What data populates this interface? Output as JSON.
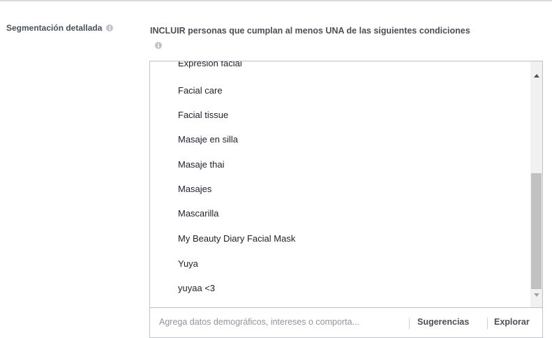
{
  "detailed_targeting": {
    "label": "Segmentación detallada",
    "info_icon": "i",
    "include_heading": "INCLUIR personas que cumplan al menos UNA de las siguientes condiciones",
    "include_info_icon": "i"
  },
  "targeting_list": {
    "partial_item": "Expresión facial",
    "items": [
      "Facial care",
      "Facial tissue",
      "Masaje en silla",
      "Masaje thai",
      "Masajes",
      "Mascarilla",
      "My Beauty Diary Facial Mask",
      "Yuya",
      "yuyaa <3"
    ]
  },
  "search": {
    "placeholder": "Agrega datos demográficos, intereses o comporta...",
    "suggestions_label": "Sugerencias",
    "explore_label": "Explorar"
  }
}
